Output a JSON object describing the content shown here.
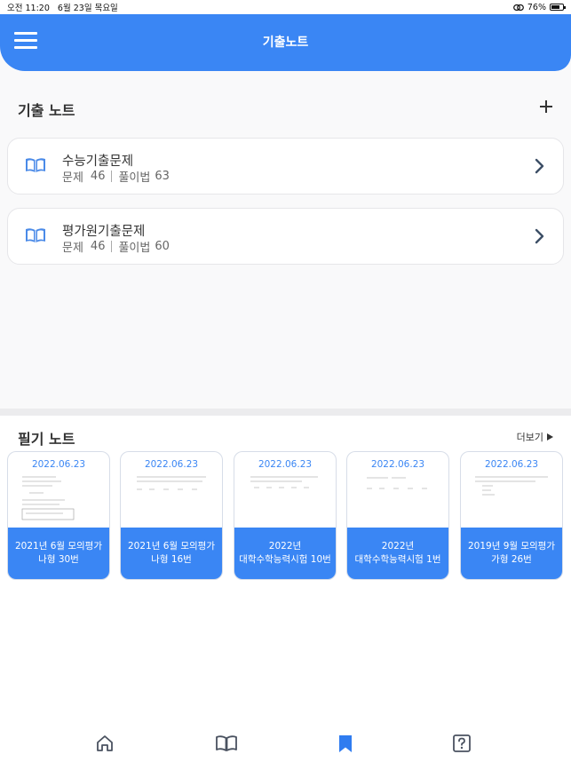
{
  "status": {
    "time": "오전 11:20",
    "date": "6월 23일 목요일",
    "battery": "76%",
    "battery_level": 0.76
  },
  "header": {
    "title": "기출노트"
  },
  "past_notes": {
    "title": "기출 노트",
    "items": [
      {
        "name": "수능기출문제",
        "problems_label": "문제",
        "problems": "46",
        "solutions_label": "풀이법",
        "solutions": "63"
      },
      {
        "name": "평가원기출문제",
        "problems_label": "문제",
        "problems": "46",
        "solutions_label": "풀이법",
        "solutions": "60"
      }
    ]
  },
  "writing_notes": {
    "title": "필기 노트",
    "more": "더보기",
    "cards": [
      {
        "date": "2022.06.23",
        "line1": "2021년 6월 모의평가",
        "line2": "나형 30번"
      },
      {
        "date": "2022.06.23",
        "line1": "2021년 6월 모의평가",
        "line2": "나형 16번"
      },
      {
        "date": "2022.06.23",
        "line1": "2022년",
        "line2": "대학수학능력시험 10번"
      },
      {
        "date": "2022.06.23",
        "line1": "2022년",
        "line2": "대학수학능력시험 1번"
      },
      {
        "date": "2022.06.23",
        "line1": "2019년 9월 모의평가",
        "line2": "가형 26번"
      }
    ]
  },
  "tabbar": {
    "active": "bookmark-tab",
    "tabs": [
      "home-icon",
      "book-icon",
      "bookmark-icon",
      "question-icon"
    ]
  },
  "colors": {
    "accent": "#3a86f4",
    "background": "#f9f9fa"
  }
}
